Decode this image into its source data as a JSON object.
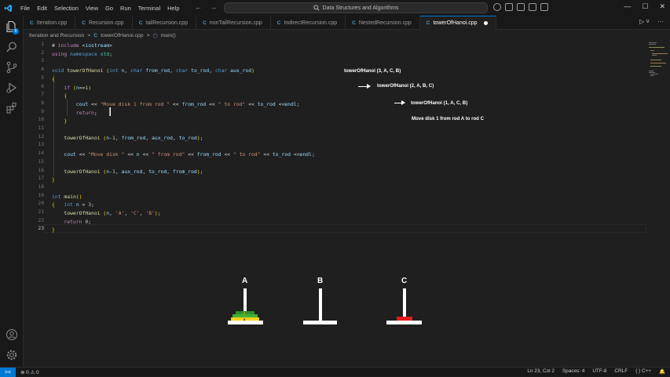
{
  "menu": [
    "File",
    "Edit",
    "Selection",
    "View",
    "Go",
    "Run",
    "Terminal",
    "Help"
  ],
  "nav": {
    "back": "←",
    "forward": "→"
  },
  "search": {
    "text": "Data Structures and Algorithms",
    "icon": "search-icon"
  },
  "window": {
    "minimize": "—",
    "maximize": "☐",
    "close": "✕"
  },
  "activity": {
    "explorer_badge": "6"
  },
  "tabs": [
    {
      "label": "Iteration.cpp",
      "icon_text": "C"
    },
    {
      "label": "Recursion.cpp",
      "icon_text": "C"
    },
    {
      "label": "tailRecursion.cpp",
      "icon_text": "C"
    },
    {
      "label": "nonTailRecursion.cpp",
      "icon_text": "C"
    },
    {
      "label": "IndirectRecursion.cpp",
      "icon_text": "C"
    },
    {
      "label": "NestedRecursion.cpp",
      "icon_text": "C"
    },
    {
      "label": "towerOfHanoi.cpp",
      "icon_text": "C",
      "active": true
    }
  ],
  "breadcrumb": {
    "folder": "Iteration and Recursion",
    "file": "towerOfHanoi.cpp",
    "symbol": "main()",
    "sep": ">"
  },
  "editor": {
    "current_line": 23,
    "lines": [
      {
        "n": "1",
        "text": "# include <iostream>"
      },
      {
        "n": "2",
        "text": "using namespace std;"
      },
      {
        "n": "3",
        "text": ""
      },
      {
        "n": "4",
        "text": "void towerOfHanoi (int n, char from_rod, char to_rod, char aux_rod)"
      },
      {
        "n": "5",
        "text": "{"
      },
      {
        "n": "6",
        "text": "    if (n==1)"
      },
      {
        "n": "7",
        "text": "    {"
      },
      {
        "n": "8",
        "text": "        cout << \"Move disk 1 from rod \" << from_rod << \" to rod\" << to_rod <<endl;"
      },
      {
        "n": "9",
        "text": "        return;"
      },
      {
        "n": "10",
        "text": "    }"
      },
      {
        "n": "11",
        "text": ""
      },
      {
        "n": "12",
        "text": "    towerOfHanoi (n-1, from_rod, aux_rod, to_rod);"
      },
      {
        "n": "13",
        "text": ""
      },
      {
        "n": "14",
        "text": "    cout << \"Move disk \" << n << \" from rod\" << from_rod << \" to rod\" << to_rod <<endl;"
      },
      {
        "n": "15",
        "text": ""
      },
      {
        "n": "16",
        "text": "    towerOfHanoi (n-1, aux_rod, to_rod, from_rod);"
      },
      {
        "n": "17",
        "text": "}"
      },
      {
        "n": "18",
        "text": ""
      },
      {
        "n": "19",
        "text": "int main()"
      },
      {
        "n": "20",
        "text": "{   int n = 3;"
      },
      {
        "n": "21",
        "text": "    towerOfHanoi (n, 'A', 'C', 'B');"
      },
      {
        "n": "22",
        "text": "    return 0;"
      },
      {
        "n": "23",
        "text": "}"
      }
    ]
  },
  "annotations": {
    "call1": "towerOfHanoi (3, A, C, B)",
    "call2": "towerOfHanoi (2, A, B, C)",
    "call3": "towerOfHanoi (1, A, C, B)",
    "output": "Move disk 1 from rod A to rod C"
  },
  "hanoi": {
    "rods": [
      "A",
      "B",
      "C"
    ],
    "disks": [
      {
        "rod": "A",
        "color": "#44b035",
        "size": "large"
      },
      {
        "rod": "A",
        "color": "#f5d11c",
        "size": "large",
        "label": "3"
      },
      {
        "rod": "A",
        "color": "#f5d11c",
        "size": "medium",
        "label": "2"
      },
      {
        "rod": "C",
        "color": "#e21b1b",
        "size": "small"
      }
    ]
  },
  "status": {
    "remote": "><",
    "problems": "⊗ 0 ⚠ 0",
    "position": "Ln 23, Col 2",
    "spaces": "Spaces: 4",
    "encoding": "UTF-8",
    "eol": "CRLF",
    "language": "{ } C++",
    "notifications": "🔔"
  },
  "colors": {
    "accent": "#0078d4",
    "editor_bg": "#1f1f1f",
    "chrome_bg": "#181818"
  }
}
